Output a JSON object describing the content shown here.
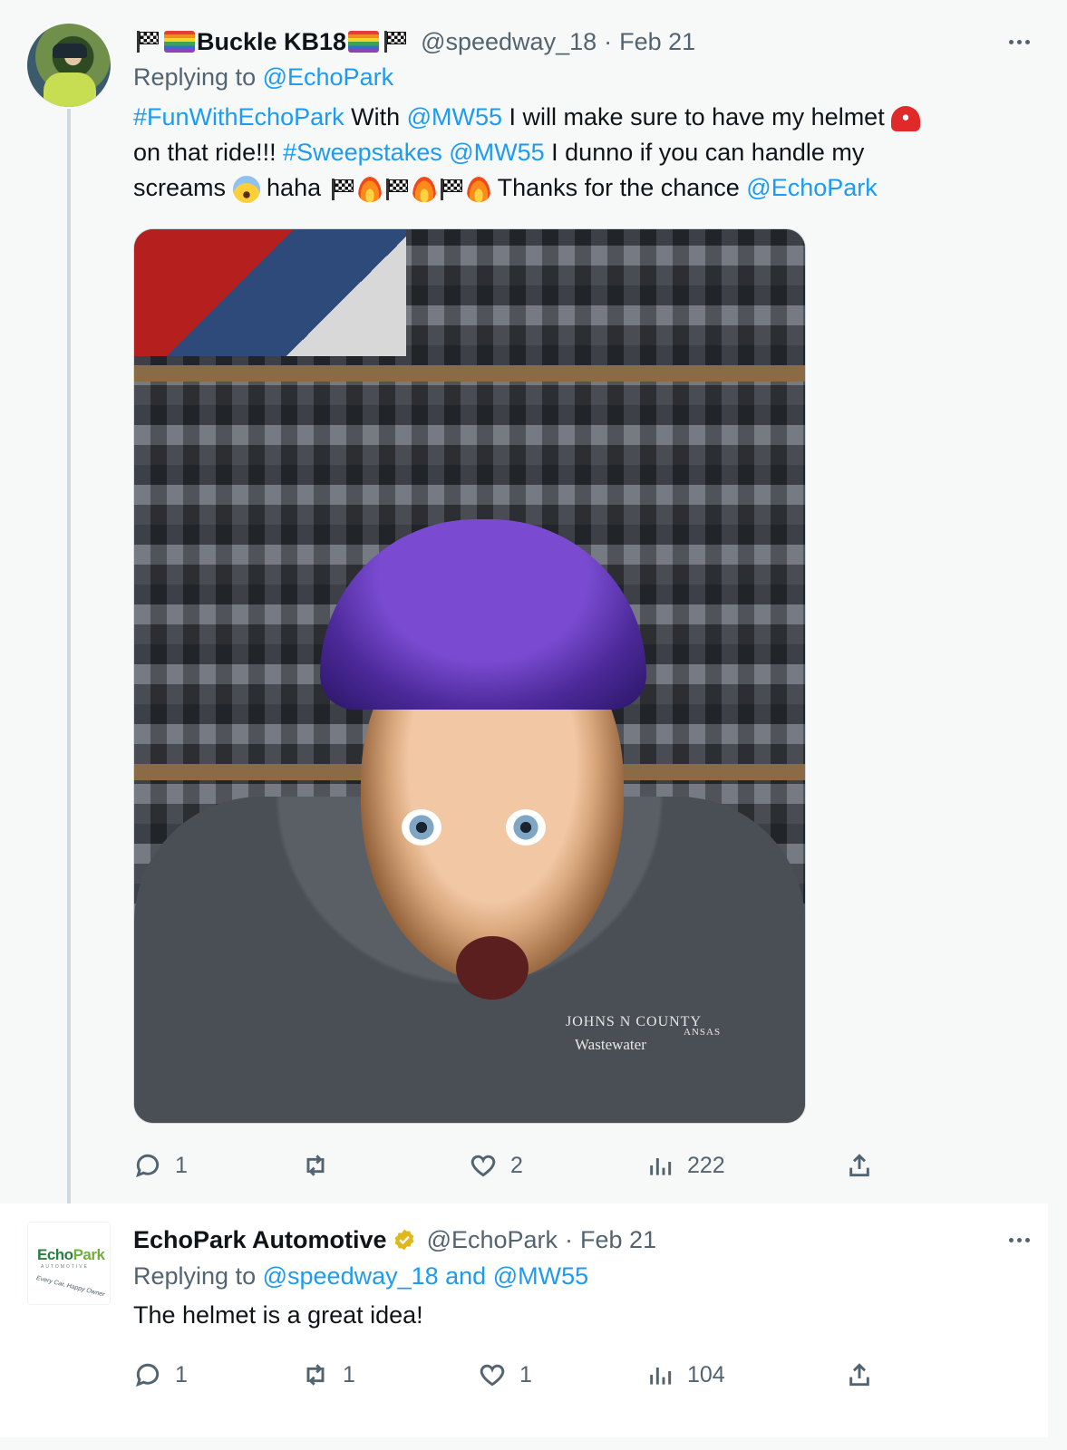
{
  "tweets": [
    {
      "author": {
        "display_name": "Buckle KB18",
        "handle": "@speedway_18",
        "date": "Feb 21",
        "separator": "·"
      },
      "replying_to_label": "Replying to",
      "replying_to": "@EchoPark",
      "text_segments": {
        "tag1": "#FunWithEchoPark",
        "t1": " With ",
        "m1": "@MW55",
        "t2": " I will make sure to have my helmet ",
        "t3": " on that ride!!! ",
        "tag2": "#Sweepstakes",
        "t4": "  ",
        "m2": "@MW55",
        "t5": " I dunno if you can handle my",
        "t6": "screams ",
        "t7": " haha ",
        "t8": " Thanks for the chance ",
        "m3": "@EchoPark"
      },
      "photo": {
        "shirt_line1": "JOHNS  N COUNTY",
        "shirt_line1b": "ANSAS",
        "shirt_line2": "Wastewater"
      },
      "actions": {
        "reply_count": "1",
        "retweet_count": "",
        "like_count": "2",
        "views_count": "222"
      },
      "icons": [
        "flag-icon",
        "rainbow-icon",
        "helmet-icon",
        "scream-icon",
        "fire-icon",
        "reply-icon",
        "retweet-icon",
        "like-icon",
        "views-icon",
        "share-icon",
        "more-icon"
      ]
    },
    {
      "author": {
        "display_name": "EchoPark Automotive",
        "handle": "@EchoPark",
        "date": "Feb 21",
        "separator": "·"
      },
      "avatar_logo": {
        "word1": "Echo",
        "word2": "Park",
        "sub": "AUTOMOTIVE",
        "tagline": "Every Car, Happy Owner"
      },
      "replying_to_label": "Replying to",
      "replying_to": "@speedway_18 and @MW55",
      "text": "The helmet is a great idea!",
      "actions": {
        "reply_count": "1",
        "retweet_count": "1",
        "like_count": "1",
        "views_count": "104"
      },
      "icons": [
        "verified-icon",
        "reply-icon",
        "retweet-icon",
        "like-icon",
        "views-icon",
        "share-icon",
        "more-icon"
      ]
    }
  ],
  "colors": {
    "link": "#1d9bf0",
    "secondary_text": "#536471",
    "primary_text": "#0f1419",
    "verified_gold": "#e2b719"
  }
}
